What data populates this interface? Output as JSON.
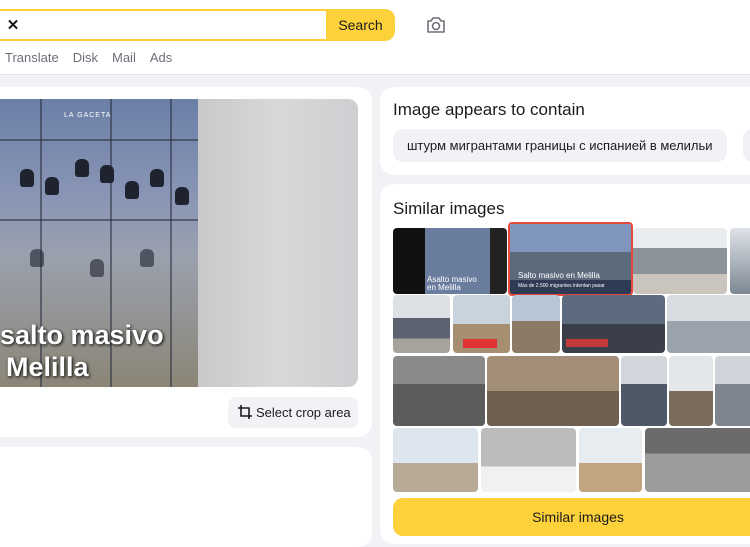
{
  "search": {
    "clear_label": "✕",
    "button_label": "Search"
  },
  "nav": [
    "Translate",
    "Disk",
    "Mail",
    "Ads"
  ],
  "preview": {
    "watermark": "LA GACETA",
    "caption_line1": "salto masivo",
    "caption_line2": "Melilla",
    "crop_button": "Select crop area"
  },
  "contains": {
    "title": "Image appears to contain",
    "chips": [
      "штурм мигрантами границы с испанией в мелильи"
    ]
  },
  "similar": {
    "title": "Similar images",
    "button_label": "Similar images",
    "thumbs": [
      {
        "label": "Asalto masivo en Melilla"
      },
      {
        "label": "Salto masivo en Melilla",
        "sublabel": "Más de 2.500 migrantes intentan pasar"
      },
      {
        "label": ""
      },
      {
        "label": ""
      },
      {
        "label": ""
      },
      {
        "label": ""
      },
      {
        "label": ""
      },
      {
        "label": ""
      },
      {
        "label": ""
      },
      {
        "label": ""
      },
      {
        "label": ""
      },
      {
        "label": ""
      },
      {
        "label": ""
      },
      {
        "label": ""
      },
      {
        "label": ""
      },
      {
        "label": ""
      },
      {
        "label": ""
      },
      {
        "label": ""
      }
    ]
  },
  "colors": {
    "accent": "#fcd13a",
    "highlight": "#e64a3d"
  },
  "icons": [
    "camera-icon",
    "crop-icon",
    "close-icon"
  ]
}
